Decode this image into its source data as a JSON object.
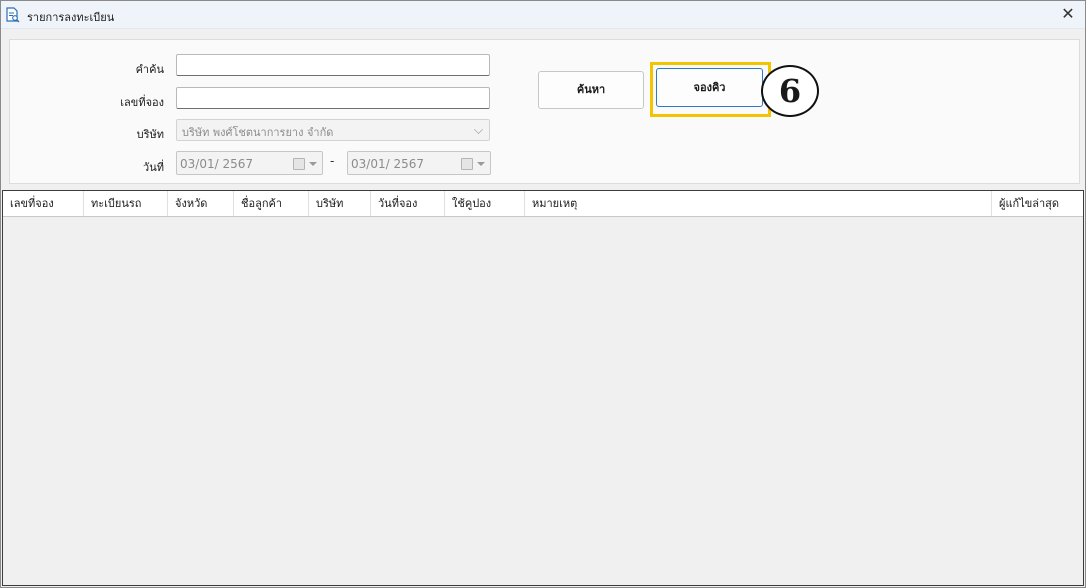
{
  "window": {
    "title": "รายการลงทะเบียน",
    "close_glyph": "✕"
  },
  "search": {
    "keyword_label": "คำค้น",
    "keyword_value": "",
    "booking_no_label": "เลขที่จอง",
    "booking_no_value": "",
    "company_label": "บริษัท",
    "company_value": "บริษัท พงศ์โชตนาการยาง จำกัด",
    "date_label": "วันที่",
    "date_from": "03/01/  2567",
    "date_separator": "-",
    "date_to": "03/01/  2567"
  },
  "buttons": {
    "search_label": "ค้นหา",
    "book_queue_label": "จองคิว"
  },
  "annotation": {
    "step_number": "6",
    "highlight_color": "#f2c500"
  },
  "grid": {
    "columns": [
      "เลขที่จอง",
      "ทะเบียนรถ",
      "จังหวัด",
      "ชื่อลูกค้า",
      "บริษัท",
      "วันที่จอง",
      "ใช้คูปอง",
      "หมายเหตุ",
      "ผู้แก้ไขล่าสุด"
    ],
    "rows": []
  }
}
